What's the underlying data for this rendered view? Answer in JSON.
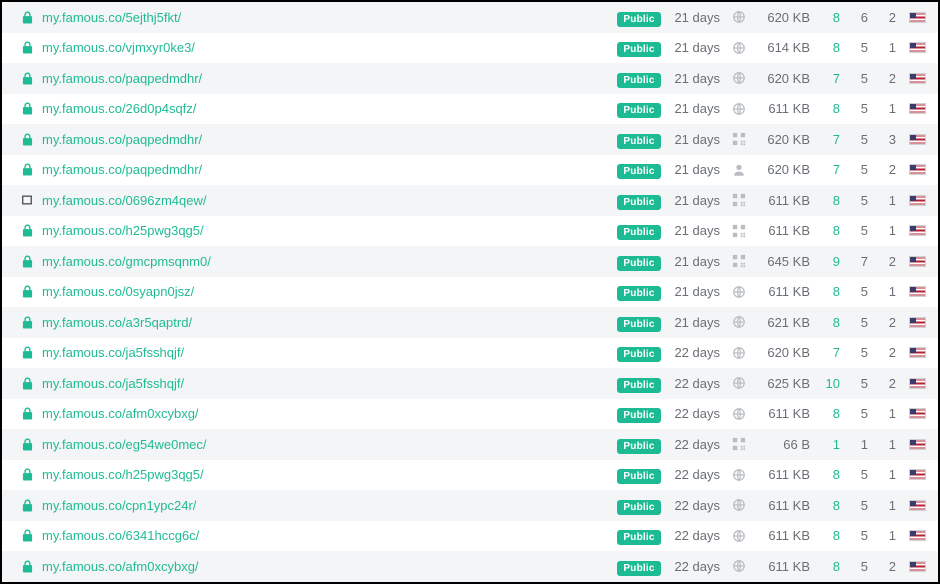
{
  "badge_label": "Public",
  "rows": [
    {
      "lock": "locked",
      "url": "my.famous.co/5ejthj5fkt/",
      "age": "21 days",
      "type": "globe",
      "size": "620 KB",
      "n1": "8",
      "n2": "6",
      "n3": "2",
      "flag": "us"
    },
    {
      "lock": "locked",
      "url": "my.famous.co/vjmxyr0ke3/",
      "age": "21 days",
      "type": "globe",
      "size": "614 KB",
      "n1": "8",
      "n2": "5",
      "n3": "1",
      "flag": "us"
    },
    {
      "lock": "locked",
      "url": "my.famous.co/paqpedmdhr/",
      "age": "21 days",
      "type": "globe",
      "size": "620 KB",
      "n1": "7",
      "n2": "5",
      "n3": "2",
      "flag": "us"
    },
    {
      "lock": "locked",
      "url": "my.famous.co/26d0p4sqfz/",
      "age": "21 days",
      "type": "globe",
      "size": "611 KB",
      "n1": "8",
      "n2": "5",
      "n3": "1",
      "flag": "us"
    },
    {
      "lock": "locked",
      "url": "my.famous.co/paqpedmdhr/",
      "age": "21 days",
      "type": "qr",
      "size": "620 KB",
      "n1": "7",
      "n2": "5",
      "n3": "3",
      "flag": "us"
    },
    {
      "lock": "locked",
      "url": "my.famous.co/paqpedmdhr/",
      "age": "21 days",
      "type": "person",
      "size": "620 KB",
      "n1": "7",
      "n2": "5",
      "n3": "2",
      "flag": "us"
    },
    {
      "lock": "open",
      "url": "my.famous.co/0696zm4qew/",
      "age": "21 days",
      "type": "qr",
      "size": "611 KB",
      "n1": "8",
      "n2": "5",
      "n3": "1",
      "flag": "us"
    },
    {
      "lock": "locked",
      "url": "my.famous.co/h25pwg3qg5/",
      "age": "21 days",
      "type": "qr",
      "size": "611 KB",
      "n1": "8",
      "n2": "5",
      "n3": "1",
      "flag": "us"
    },
    {
      "lock": "locked",
      "url": "my.famous.co/gmcpmsqnm0/",
      "age": "21 days",
      "type": "qr",
      "size": "645 KB",
      "n1": "9",
      "n2": "7",
      "n3": "2",
      "flag": "us"
    },
    {
      "lock": "locked",
      "url": "my.famous.co/0syapn0jsz/",
      "age": "21 days",
      "type": "globe",
      "size": "611 KB",
      "n1": "8",
      "n2": "5",
      "n3": "1",
      "flag": "us"
    },
    {
      "lock": "locked",
      "url": "my.famous.co/a3r5qaptrd/",
      "age": "21 days",
      "type": "globe",
      "size": "621 KB",
      "n1": "8",
      "n2": "5",
      "n3": "2",
      "flag": "us"
    },
    {
      "lock": "locked",
      "url": "my.famous.co/ja5fsshqjf/",
      "age": "22 days",
      "type": "globe",
      "size": "620 KB",
      "n1": "7",
      "n2": "5",
      "n3": "2",
      "flag": "us"
    },
    {
      "lock": "locked",
      "url": "my.famous.co/ja5fsshqjf/",
      "age": "22 days",
      "type": "globe",
      "size": "625 KB",
      "n1": "10",
      "n2": "5",
      "n3": "2",
      "flag": "us"
    },
    {
      "lock": "locked",
      "url": "my.famous.co/afm0xcybxg/",
      "age": "22 days",
      "type": "globe",
      "size": "611 KB",
      "n1": "8",
      "n2": "5",
      "n3": "1",
      "flag": "us"
    },
    {
      "lock": "locked",
      "url": "my.famous.co/eg54we0mec/",
      "age": "22 days",
      "type": "qr",
      "size": "66 B",
      "n1": "1",
      "n2": "1",
      "n3": "1",
      "flag": "us"
    },
    {
      "lock": "locked",
      "url": "my.famous.co/h25pwg3qg5/",
      "age": "22 days",
      "type": "globe",
      "size": "611 KB",
      "n1": "8",
      "n2": "5",
      "n3": "1",
      "flag": "us"
    },
    {
      "lock": "locked",
      "url": "my.famous.co/cpn1ypc24r/",
      "age": "22 days",
      "type": "globe",
      "size": "611 KB",
      "n1": "8",
      "n2": "5",
      "n3": "1",
      "flag": "us"
    },
    {
      "lock": "locked",
      "url": "my.famous.co/6341hccg6c/",
      "age": "22 days",
      "type": "globe",
      "size": "611 KB",
      "n1": "8",
      "n2": "5",
      "n3": "1",
      "flag": "us"
    },
    {
      "lock": "locked",
      "url": "my.famous.co/afm0xcybxg/",
      "age": "22 days",
      "type": "globe",
      "size": "611 KB",
      "n1": "8",
      "n2": "5",
      "n3": "2",
      "flag": "us"
    }
  ]
}
